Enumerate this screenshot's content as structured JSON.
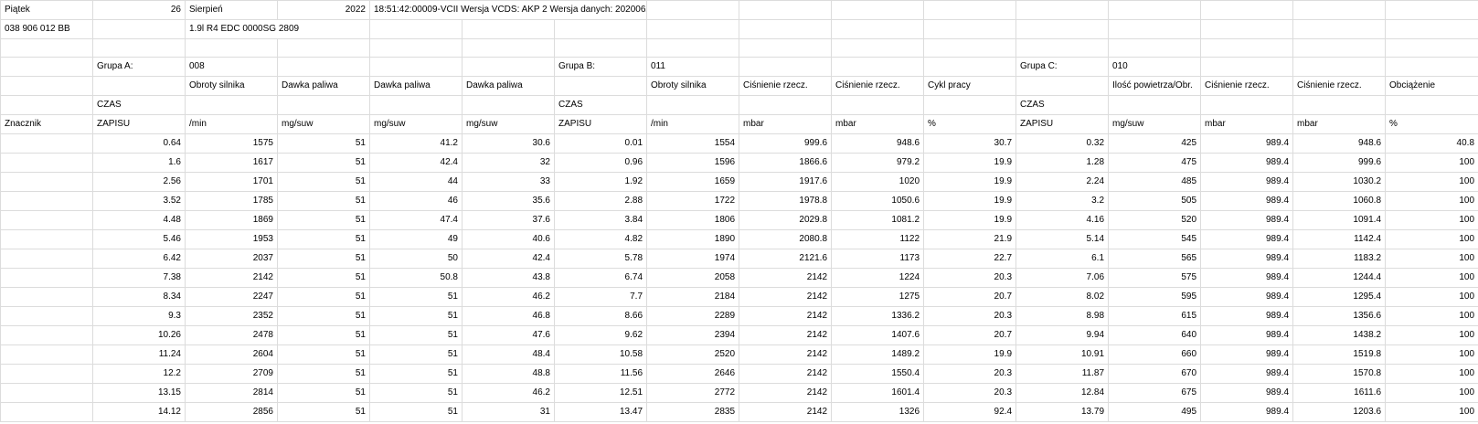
{
  "sheet": {
    "rows": [
      [
        "Piątek",
        "26",
        "Sierpień",
        "2022",
        "18:51:42:00009-VCII",
        "Wersja VCDS: AKP 2",
        "Wersja danych: 20200629 DS317.0",
        "",
        "",
        "",
        "",
        "",
        "",
        "",
        "",
        ""
      ],
      [
        "038 906 012 BB",
        "",
        "1.9l R4 EDC 0000SG  2809",
        "",
        "",
        "",
        "",
        "",
        "",
        "",
        "",
        "",
        "",
        "",
        "",
        ""
      ],
      [
        "",
        "",
        "",
        "",
        "",
        "",
        "",
        "",
        "",
        "",
        "",
        "",
        "",
        "",
        "",
        ""
      ],
      [
        "",
        "Grupa A:",
        "008",
        "",
        "",
        "",
        "Grupa B:",
        "011",
        "",
        "",
        "",
        "Grupa C:",
        "010",
        "",
        "",
        ""
      ],
      [
        "",
        "",
        "Obroty silnika",
        "Dawka paliwa",
        "Dawka paliwa",
        "Dawka paliwa",
        "",
        "Obroty silnika",
        "Ciśnienie rzecz.",
        "Ciśnienie rzecz.",
        "Cykl pracy",
        "",
        "Ilość powietrza/Obr.",
        "Ciśnienie rzecz.",
        "Ciśnienie rzecz.",
        "Obciążenie"
      ],
      [
        "",
        "CZAS",
        "",
        "",
        "",
        "",
        "CZAS",
        "",
        "",
        "",
        "",
        "CZAS",
        "",
        "",
        "",
        ""
      ],
      [
        "Znacznik",
        "ZAPISU",
        "/min",
        "mg/suw",
        "mg/suw",
        "mg/suw",
        "ZAPISU",
        "/min",
        "mbar",
        "mbar",
        "%",
        "ZAPISU",
        "mg/suw",
        "mbar",
        "mbar",
        "%"
      ],
      [
        "",
        "0.64",
        "1575",
        "51",
        "41.2",
        "30.6",
        "0.01",
        "1554",
        "999.6",
        "948.6",
        "30.7",
        "0.32",
        "425",
        "989.4",
        "948.6",
        "40.8"
      ],
      [
        "",
        "1.6",
        "1617",
        "51",
        "42.4",
        "32",
        "0.96",
        "1596",
        "1866.6",
        "979.2",
        "19.9",
        "1.28",
        "475",
        "989.4",
        "999.6",
        "100"
      ],
      [
        "",
        "2.56",
        "1701",
        "51",
        "44",
        "33",
        "1.92",
        "1659",
        "1917.6",
        "1020",
        "19.9",
        "2.24",
        "485",
        "989.4",
        "1030.2",
        "100"
      ],
      [
        "",
        "3.52",
        "1785",
        "51",
        "46",
        "35.6",
        "2.88",
        "1722",
        "1978.8",
        "1050.6",
        "19.9",
        "3.2",
        "505",
        "989.4",
        "1060.8",
        "100"
      ],
      [
        "",
        "4.48",
        "1869",
        "51",
        "47.4",
        "37.6",
        "3.84",
        "1806",
        "2029.8",
        "1081.2",
        "19.9",
        "4.16",
        "520",
        "989.4",
        "1091.4",
        "100"
      ],
      [
        "",
        "5.46",
        "1953",
        "51",
        "49",
        "40.6",
        "4.82",
        "1890",
        "2080.8",
        "1122",
        "21.9",
        "5.14",
        "545",
        "989.4",
        "1142.4",
        "100"
      ],
      [
        "",
        "6.42",
        "2037",
        "51",
        "50",
        "42.4",
        "5.78",
        "1974",
        "2121.6",
        "1173",
        "22.7",
        "6.1",
        "565",
        "989.4",
        "1183.2",
        "100"
      ],
      [
        "",
        "7.38",
        "2142",
        "51",
        "50.8",
        "43.8",
        "6.74",
        "2058",
        "2142",
        "1224",
        "20.3",
        "7.06",
        "575",
        "989.4",
        "1244.4",
        "100"
      ],
      [
        "",
        "8.34",
        "2247",
        "51",
        "51",
        "46.2",
        "7.7",
        "2184",
        "2142",
        "1275",
        "20.7",
        "8.02",
        "595",
        "989.4",
        "1295.4",
        "100"
      ],
      [
        "",
        "9.3",
        "2352",
        "51",
        "51",
        "46.8",
        "8.66",
        "2289",
        "2142",
        "1336.2",
        "20.3",
        "8.98",
        "615",
        "989.4",
        "1356.6",
        "100"
      ],
      [
        "",
        "10.26",
        "2478",
        "51",
        "51",
        "47.6",
        "9.62",
        "2394",
        "2142",
        "1407.6",
        "20.7",
        "9.94",
        "640",
        "989.4",
        "1438.2",
        "100"
      ],
      [
        "",
        "11.24",
        "2604",
        "51",
        "51",
        "48.4",
        "10.58",
        "2520",
        "2142",
        "1489.2",
        "19.9",
        "10.91",
        "660",
        "989.4",
        "1519.8",
        "100"
      ],
      [
        "",
        "12.2",
        "2709",
        "51",
        "51",
        "48.8",
        "11.56",
        "2646",
        "2142",
        "1550.4",
        "20.3",
        "11.87",
        "670",
        "989.4",
        "1570.8",
        "100"
      ],
      [
        "",
        "13.15",
        "2814",
        "51",
        "51",
        "46.2",
        "12.51",
        "2772",
        "2142",
        "1601.4",
        "20.3",
        "12.84",
        "675",
        "989.4",
        "1611.6",
        "100"
      ],
      [
        "",
        "14.12",
        "2856",
        "51",
        "51",
        "31",
        "13.47",
        "2835",
        "2142",
        "1326",
        "92.4",
        "13.79",
        "495",
        "989.4",
        "1203.6",
        "100"
      ]
    ]
  }
}
